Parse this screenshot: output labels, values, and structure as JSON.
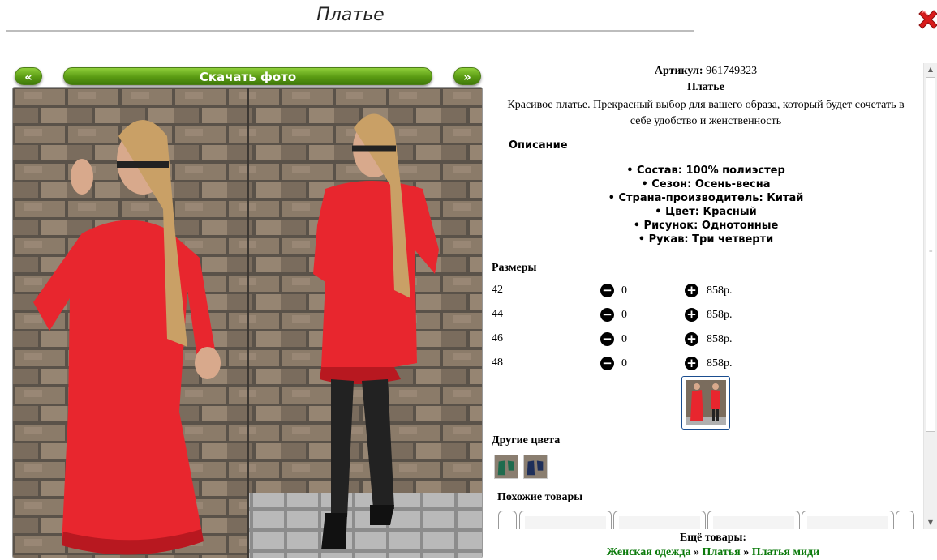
{
  "header": {
    "title": "Платье"
  },
  "gallery": {
    "prev_label": "«",
    "download_label": "Скачать фото",
    "next_label": "»"
  },
  "product": {
    "article_label": "Артикул:",
    "article_value": "961749323",
    "name": "Платье",
    "description": "Красивое платье. Прекрасный выбор для вашего образа, который будет сочетать в себе удобство и женственность",
    "description_heading": "Описание",
    "attributes": [
      "Состав: 100% полиэстер",
      "Сезон: Осень-весна",
      "Страна-производитель: Китай",
      "Цвет: Красный",
      "Рисунок: Однотонные",
      "Рукав: Три четверти"
    ]
  },
  "sizes": {
    "heading": "Размеры",
    "rows": [
      {
        "size": "42",
        "qty": "0",
        "price": "858р."
      },
      {
        "size": "44",
        "qty": "0",
        "price": "858р."
      },
      {
        "size": "46",
        "qty": "0",
        "price": "858р."
      },
      {
        "size": "48",
        "qty": "0",
        "price": "858р."
      }
    ]
  },
  "other_colors": {
    "heading": "Другие цвета"
  },
  "similar": {
    "heading": "Похожие товары"
  },
  "more": {
    "heading": "Ещё товары:",
    "crumbs": [
      "Женская одежда",
      "Платья",
      "Платья миди"
    ],
    "separator": "»"
  },
  "colors": {
    "accent_green": "#5a9b13",
    "link_green": "#0b7a0b",
    "close_red": "#d81b1b",
    "dress_red": "#e8262e"
  },
  "icons": {
    "close": "close-x-icon",
    "minus": "minus-circle-icon",
    "plus": "plus-circle-icon"
  }
}
